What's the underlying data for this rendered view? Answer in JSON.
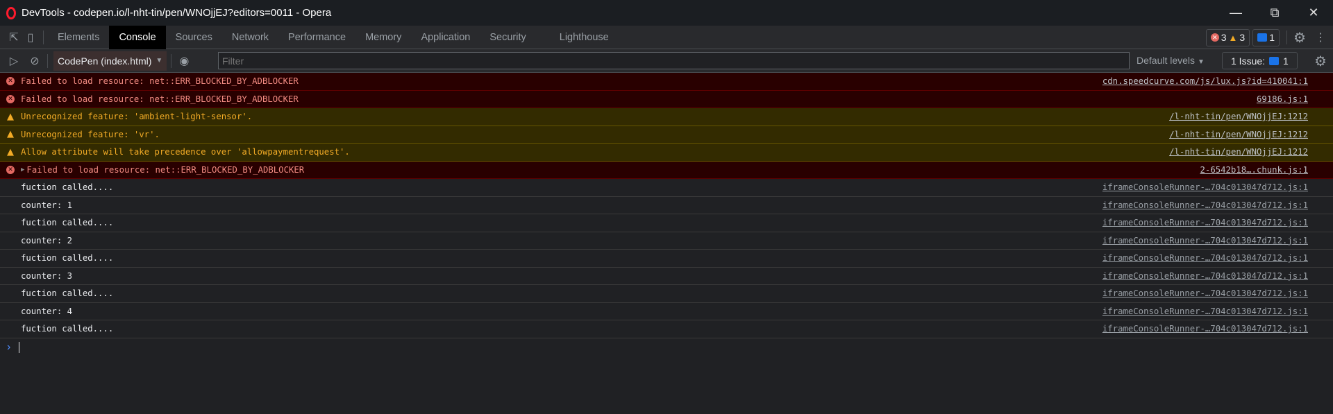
{
  "window": {
    "title": "DevTools - codepen.io/l-nht-tin/pen/WNOjjEJ?editors=0011 - Opera",
    "controls": [
      "minimize",
      "restore",
      "close"
    ]
  },
  "tabs": [
    "Elements",
    "Console",
    "Sources",
    "Network",
    "Performance",
    "Memory",
    "Application",
    "Security",
    "Lighthouse"
  ],
  "active_tab": "Console",
  "status": {
    "errors": "3",
    "warnings": "3",
    "messages": "1"
  },
  "toolbar": {
    "context": "CodePen (index.html)",
    "filter_placeholder": "Filter",
    "levels": "Default levels",
    "issues_label": "1 Issue:",
    "issues_count": "1"
  },
  "logs": [
    {
      "level": "error",
      "text": "Failed to load resource: net::ERR_BLOCKED_BY_ADBLOCKER",
      "source": "cdn.speedcurve.com/js/lux.js?id=410041:1"
    },
    {
      "level": "error",
      "text": "Failed to load resource: net::ERR_BLOCKED_BY_ADBLOCKER",
      "source": "69186.js:1"
    },
    {
      "level": "warning",
      "text": "Unrecognized feature: 'ambient-light-sensor'.",
      "source": "/l-nht-tin/pen/WNOjjEJ:1212"
    },
    {
      "level": "warning",
      "text": "Unrecognized feature: 'vr'.",
      "source": "/l-nht-tin/pen/WNOjjEJ:1212"
    },
    {
      "level": "warning",
      "text": "Allow attribute will take precedence over 'allowpaymentrequest'.",
      "source": "/l-nht-tin/pen/WNOjjEJ:1212"
    },
    {
      "level": "error",
      "expandable": true,
      "text": "Failed to load resource: net::ERR_BLOCKED_BY_ADBLOCKER",
      "source": "2-6542b18….chunk.js:1"
    },
    {
      "level": "log",
      "text": "fuction called....",
      "source": "iframeConsoleRunner-…704c013047d712.js:1"
    },
    {
      "level": "log",
      "text": "counter: 1",
      "source": "iframeConsoleRunner-…704c013047d712.js:1"
    },
    {
      "level": "log",
      "text": "fuction called....",
      "source": "iframeConsoleRunner-…704c013047d712.js:1"
    },
    {
      "level": "log",
      "text": "counter: 2",
      "source": "iframeConsoleRunner-…704c013047d712.js:1"
    },
    {
      "level": "log",
      "text": "fuction called....",
      "source": "iframeConsoleRunner-…704c013047d712.js:1"
    },
    {
      "level": "log",
      "text": "counter: 3",
      "source": "iframeConsoleRunner-…704c013047d712.js:1"
    },
    {
      "level": "log",
      "text": "fuction called....",
      "source": "iframeConsoleRunner-…704c013047d712.js:1"
    },
    {
      "level": "log",
      "text": "counter: 4",
      "source": "iframeConsoleRunner-…704c013047d712.js:1"
    },
    {
      "level": "log",
      "text": "fuction called....",
      "source": "iframeConsoleRunner-…704c013047d712.js:1"
    }
  ]
}
